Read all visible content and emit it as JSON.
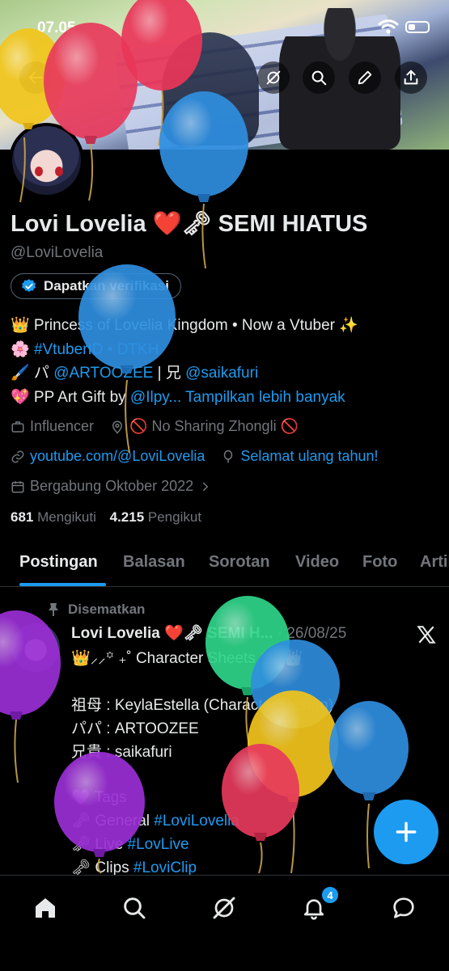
{
  "status_bar": {
    "time": "07.05"
  },
  "profile": {
    "name": "Lovi Lovelia ❤️🗝 SEMI HIATUS",
    "handle": "@LoviLovelia",
    "verify_button": "Dapatkan verifikasi",
    "bio": {
      "line1": "👑 Princess of Lovelia Kingdom • Now a Vtuber ✨",
      "line2_prefix": "🌸 ",
      "line2_tags": "#VtuberID • DTKH",
      "line3_prefix": "🖌️ パ ",
      "line3_link1": "@ARTOOZEE",
      "line3_mid": " | 兄 ",
      "line3_link2": "@saikafuri",
      "line4_prefix": "💖 PP Art Gift by ",
      "line4_link": "@Ilpy...",
      "line4_more": "Tampilkan lebih banyak"
    },
    "category": "Influencer",
    "location": "🚫 No Sharing Zhongli 🚫",
    "website": "youtube.com/@LoviLovelia",
    "birthday": "Selamat ulang tahun!",
    "joined": "Bergabung Oktober 2022",
    "following_count": "681",
    "following_label": "Mengikuti",
    "followers_count": "4.215",
    "followers_label": "Pengikut"
  },
  "tabs": [
    "Postingan",
    "Balasan",
    "Sorotan",
    "Video",
    "Foto",
    "Artikel"
  ],
  "post": {
    "pinned_label": "Disematkan",
    "author": "Lovi Lovelia ❤️🗝 SEMI H...",
    "date": "· 26/08/25",
    "line1": "👑⸝⸝꙳ ₊˚ Character Sheets ꙳⸝⸝👑",
    "line2": "祖母 : KeylaEstella (Character Design)",
    "line3": "パパ : ARTOOZEE",
    "line4": "兄貴 : saikafuri",
    "line5": "💜 Tags",
    "line6_prefix": "🗝 General ",
    "line6_tag": "#LoviLovelia",
    "line7_prefix": "🗝 Live ",
    "line7_tag": "#LovLive",
    "line8_prefix": "🗝 Clips ",
    "line8_tag": "#LoviClip"
  },
  "navigation": {
    "notifications_badge": "4",
    "items": [
      "home-icon",
      "search-icon",
      "grok-icon",
      "bell-icon",
      "messages-icon"
    ]
  },
  "colors": {
    "accent": "#1d9bf0",
    "background": "#000000",
    "secondary_text": "#71767b"
  }
}
